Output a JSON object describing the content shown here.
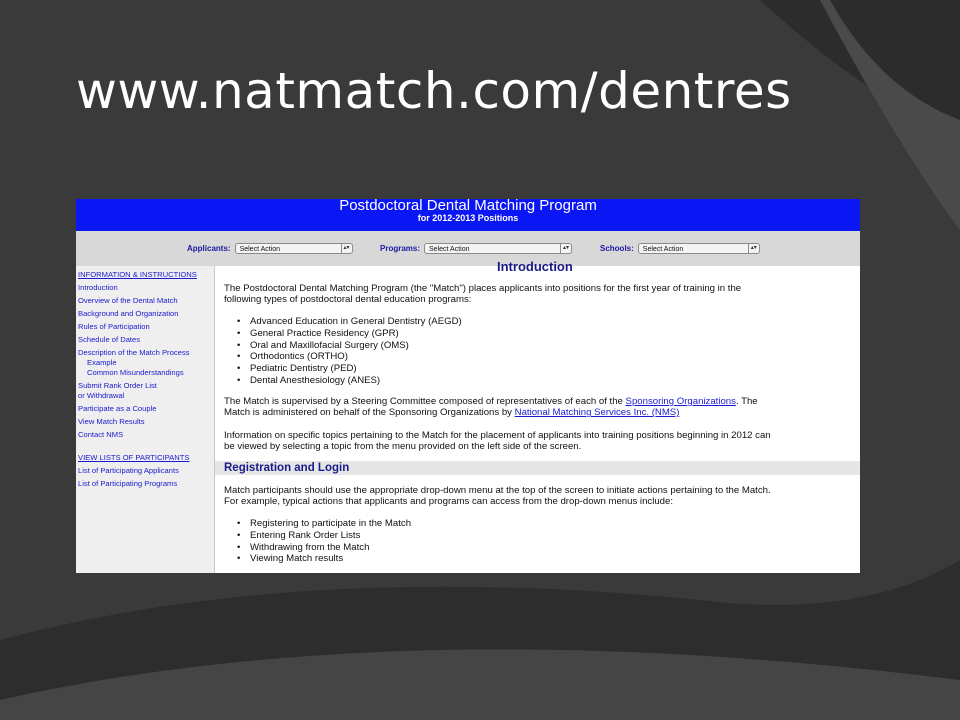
{
  "slide": {
    "title": "www.natmatch.com/dentres"
  },
  "banner": {
    "title": "Postdoctoral Dental Matching Program",
    "subtitle": "for 2012-2013 Positions"
  },
  "action_bar": {
    "groups": [
      {
        "label": "Applicants:",
        "selected": "Select Action"
      },
      {
        "label": "Programs:",
        "selected": "Select Action"
      },
      {
        "label": "Schools:",
        "selected": "Select Action"
      }
    ]
  },
  "sidebar": {
    "items": [
      {
        "label": "INFORMATION & INSTRUCTIONS"
      },
      {
        "label": "Introduction"
      },
      {
        "label": "Overview of the Dental Match"
      },
      {
        "label": "Background and Organization"
      },
      {
        "label": "Rules of Participation"
      },
      {
        "label": "Schedule of Dates"
      },
      {
        "label": "Description of the Match Process"
      },
      {
        "label": "Example"
      },
      {
        "label": "Common Misunderstandings"
      },
      {
        "label": "Submit Rank Order List"
      },
      {
        "label": "or Withdrawal"
      },
      {
        "label": "Participate as a Couple"
      },
      {
        "label": "View Match Results"
      },
      {
        "label": "Contact NMS"
      },
      {
        "label": "VIEW LISTS OF PARTICIPANTS"
      },
      {
        "label": "List of Participating Applicants"
      },
      {
        "label": "List of Participating Programs"
      }
    ]
  },
  "main": {
    "intro_heading": "Introduction",
    "p1_line1": "The Postdoctoral Dental Matching Program (the \"Match\") places applicants into positions for the first year of training in the",
    "p1_line2": "following types of postdoctoral dental education programs:",
    "program_types": [
      "Advanced Education in General Dentistry (AEGD)",
      "General Practice Residency (GPR)",
      "Oral and Maxillofacial Surgery (OMS)",
      "Orthodontics (ORTHO)",
      "Pediatric Dentistry (PED)",
      "Dental Anesthesiology (ANES)"
    ],
    "p2_line1_a": "The Match is supervised by a Steering Committee composed of representatives of each of the ",
    "p2_link1": "Sponsoring Organizations",
    "p2_line1_b": ". The",
    "p2_line2_a": "Match is administered on behalf of the Sponsoring Organizations by ",
    "p2_link2": "National Matching Services Inc. (NMS)",
    "p3_line1": "Information on specific topics pertaining to the Match for the placement of applicants into training positions beginning in 2012 can",
    "p3_line2": "be viewed by selecting a topic from the menu provided on the left side of the screen.",
    "section_title": "Registration and Login",
    "p4_line1": "Match participants should use the appropriate drop-down menu at the top of the screen to initiate actions pertaining to the Match.",
    "p4_line2": "For example, typical actions that applicants and programs can access from the drop-down menus include:",
    "actions": [
      "Registering to participate in the Match",
      "Entering Rank Order Lists",
      "Withdrawing from the Match",
      "Viewing Match results"
    ]
  }
}
